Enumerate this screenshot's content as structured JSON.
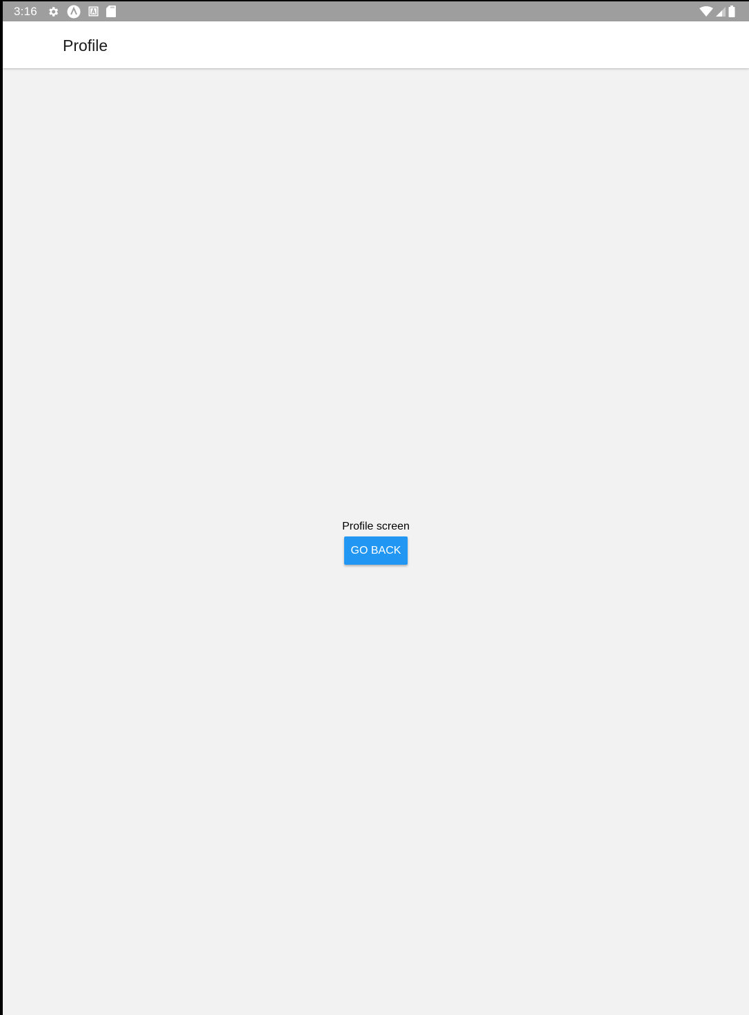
{
  "status_bar": {
    "time": "3:16",
    "left_icons": [
      "settings-icon",
      "app-notification-icon",
      "keyboard-icon",
      "sd-card-icon"
    ],
    "right_icons": [
      "wifi-icon",
      "signal-icon",
      "battery-icon"
    ],
    "background": "#9e9e9e"
  },
  "app_bar": {
    "title": "Profile"
  },
  "main": {
    "message": "Profile screen",
    "go_back_label": "GO BACK",
    "button_color": "#2196f3"
  }
}
